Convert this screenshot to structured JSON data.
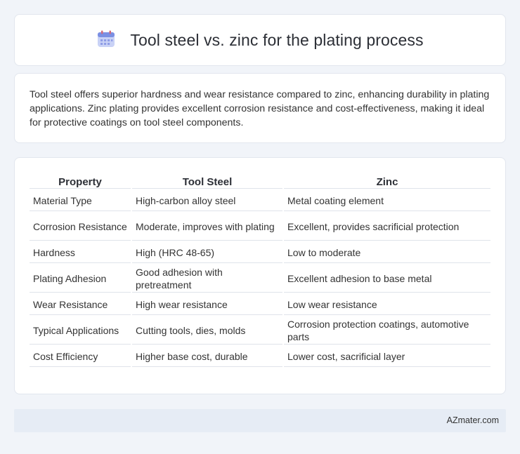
{
  "header": {
    "title": "Tool steel vs. zinc for the plating process",
    "icon": "calendar-icon"
  },
  "summary": {
    "text": "Tool steel offers superior hardness and wear resistance compared to zinc, enhancing durability in plating applications. Zinc plating provides excellent corrosion resistance and cost-effectiveness, making it ideal for protective coatings on tool steel components."
  },
  "table": {
    "headers": [
      "Property",
      "Tool Steel",
      "Zinc"
    ],
    "rows": [
      [
        "Material Type",
        "High-carbon alloy steel",
        "Metal coating element"
      ],
      [
        "Corrosion Resistance",
        "Moderate, improves with plating",
        "Excellent, provides sacrificial protection"
      ],
      [
        "Hardness",
        "High (HRC 48-65)",
        "Low to moderate"
      ],
      [
        "Plating Adhesion",
        "Good adhesion with pretreatment",
        "Excellent adhesion to base metal"
      ],
      [
        "Wear Resistance",
        "High wear resistance",
        "Low wear resistance"
      ],
      [
        "Typical Applications",
        "Cutting tools, dies, molds",
        "Corrosion protection coatings, automotive parts"
      ],
      [
        "Cost Efficiency",
        "Higher base cost, durable",
        "Lower cost, sacrificial layer"
      ]
    ]
  },
  "footer": {
    "brand": "AZmater.com"
  },
  "colors": {
    "background": "#f1f4f9",
    "card": "#ffffff",
    "footer_bg": "#e6ecf5",
    "icon_accent": "#7a8fe0"
  }
}
